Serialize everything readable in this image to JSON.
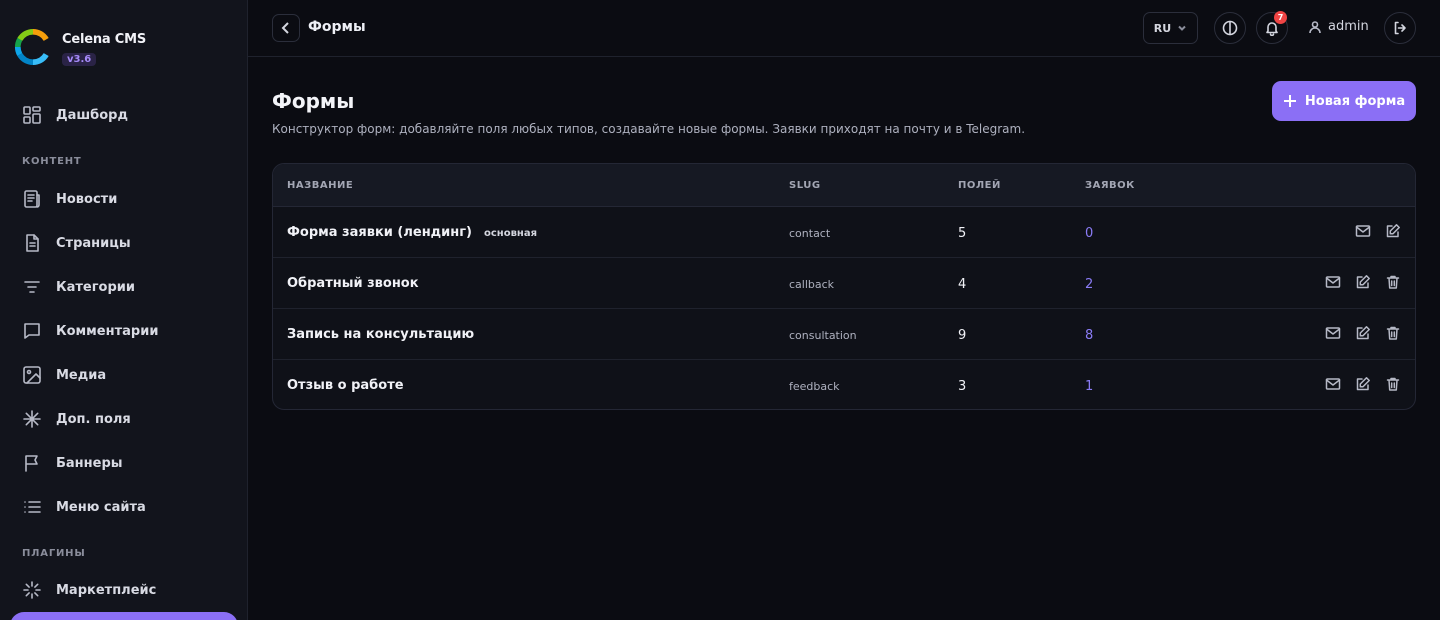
{
  "brand": {
    "name": "Celena CMS",
    "version": "v3.6"
  },
  "sidebar": {
    "top_item": {
      "label": "Дашборд",
      "icon": "dashboard-icon"
    },
    "section_content": "КОНТЕНТ",
    "items": [
      {
        "label": "Новости",
        "icon": "news-icon"
      },
      {
        "label": "Страницы",
        "icon": "page-icon"
      },
      {
        "label": "Категории",
        "icon": "filter-icon"
      },
      {
        "label": "Комментарии",
        "icon": "comment-icon"
      },
      {
        "label": "Медиа",
        "icon": "image-icon"
      },
      {
        "label": "Доп. поля",
        "icon": "asterisk-icon"
      },
      {
        "label": "Баннеры",
        "icon": "flag-icon"
      },
      {
        "label": "Меню сайта",
        "icon": "list-icon"
      }
    ],
    "section_plugins": "ПЛАГИНЫ",
    "plugins": [
      {
        "label": "Маркетплейс",
        "icon": "loader-icon"
      }
    ]
  },
  "header": {
    "title": "Формы",
    "lang": "RU",
    "notifications_count": "7",
    "user": "admin"
  },
  "main": {
    "title": "Формы",
    "description": "Конструктор форм: добавляйте поля любых типов, создавайте новые формы. Заявки приходят на почту и в Telegram.",
    "new_button": "Новая форма"
  },
  "table": {
    "columns": [
      "НАЗВАНИЕ",
      "SLUG",
      "ПОЛЕЙ",
      "ЗАЯВОК"
    ],
    "rows": [
      {
        "name": "Форма заявки (лендинг)",
        "tag": "основная",
        "slug": "contact",
        "fields": "5",
        "submissions": "0",
        "deletable": false
      },
      {
        "name": "Обратный звонок",
        "tag": "",
        "slug": "callback",
        "fields": "4",
        "submissions": "2",
        "deletable": true
      },
      {
        "name": "Запись на консультацию",
        "tag": "",
        "slug": "consultation",
        "fields": "9",
        "submissions": "8",
        "deletable": true
      },
      {
        "name": "Отзыв о работе",
        "tag": "",
        "slug": "feedback",
        "fields": "3",
        "submissions": "1",
        "deletable": true
      }
    ]
  },
  "colors": {
    "accent": "#8b6ff5",
    "link": "#8b7cf6",
    "badge": "#ef4444",
    "background": "#0b0c12",
    "sidebar": "#12141c"
  }
}
